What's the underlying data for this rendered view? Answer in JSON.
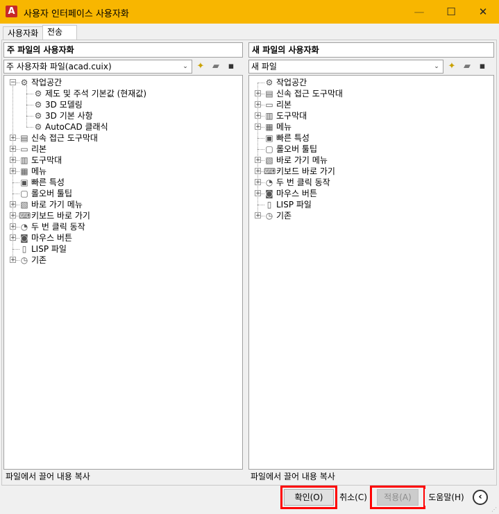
{
  "window": {
    "title": "사용자 인터페이스 사용자화",
    "app_icon_letter": "A",
    "minimize_glyph": "—",
    "maximize_glyph": "☐",
    "close_glyph": "✕"
  },
  "tabs": [
    {
      "label": "사용자화",
      "active": false
    },
    {
      "label": "전송",
      "active": true
    }
  ],
  "left_pane": {
    "header": "주 파일의 사용자화",
    "file_combo_value": "주 사용자화 파일(acad.cuix)",
    "status": "파일에서 끌어 내용 복사",
    "tree": [
      {
        "label": "작업공간",
        "level": 0,
        "icon": "workspace-gear-icon",
        "glyph": "⚙",
        "expander": "−"
      },
      {
        "label": "제도 및 주석 기본값 (현재값)",
        "level": 1,
        "icon": "gear-icon",
        "glyph": "⚙",
        "expander": ""
      },
      {
        "label": "3D 모델링",
        "level": 1,
        "icon": "gear-icon",
        "glyph": "⚙",
        "expander": ""
      },
      {
        "label": "3D 기본 사항",
        "level": 1,
        "icon": "gear-icon",
        "glyph": "⚙",
        "expander": ""
      },
      {
        "label": "AutoCAD 클래식",
        "level": 1,
        "icon": "gear-icon",
        "glyph": "⚙",
        "expander": ""
      },
      {
        "label": "신속 접근 도구막대",
        "level": 0,
        "icon": "quick-access-toolbar-icon",
        "glyph": "▤",
        "expander": "+"
      },
      {
        "label": "리본",
        "level": 0,
        "icon": "ribbon-folder-icon",
        "glyph": "▭",
        "expander": "+"
      },
      {
        "label": "도구막대",
        "level": 0,
        "icon": "toolbar-icon",
        "glyph": "▥",
        "expander": "+"
      },
      {
        "label": "메뉴",
        "level": 0,
        "icon": "menu-icon",
        "glyph": "▦",
        "expander": "+"
      },
      {
        "label": "빠른 특성",
        "level": 0,
        "icon": "quick-properties-icon",
        "glyph": "▣",
        "expander": ""
      },
      {
        "label": "롤오버 툴팁",
        "level": 0,
        "icon": "rollover-tooltip-icon",
        "glyph": "▢",
        "expander": ""
      },
      {
        "label": "바로 가기 메뉴",
        "level": 0,
        "icon": "shortcut-menu-icon",
        "glyph": "▧",
        "expander": "+"
      },
      {
        "label": "키보드 바로 가기",
        "level": 0,
        "icon": "keyboard-shortcut-icon",
        "glyph": "⌨",
        "expander": "+"
      },
      {
        "label": "두 번 클릭 동작",
        "level": 0,
        "icon": "double-click-icon",
        "glyph": "◔",
        "expander": "+"
      },
      {
        "label": "마우스 버튼",
        "level": 0,
        "icon": "mouse-button-icon",
        "glyph": "◙",
        "expander": "+"
      },
      {
        "label": "LISP 파일",
        "level": 0,
        "icon": "lisp-file-icon",
        "glyph": "▯",
        "expander": ""
      },
      {
        "label": "기존",
        "level": 0,
        "icon": "legacy-clock-icon",
        "glyph": "◷",
        "expander": "+"
      }
    ]
  },
  "right_pane": {
    "header": "새 파일의 사용자화",
    "file_combo_value": "새 파일",
    "status": "파일에서 끌어 내용 복사",
    "tree": [
      {
        "label": "작업공간",
        "level": 0,
        "icon": "workspace-gear-icon",
        "glyph": "⚙",
        "expander": ""
      },
      {
        "label": "신속 접근 도구막대",
        "level": 0,
        "icon": "quick-access-toolbar-icon",
        "glyph": "▤",
        "expander": "+"
      },
      {
        "label": "리본",
        "level": 0,
        "icon": "ribbon-folder-icon",
        "glyph": "▭",
        "expander": "+"
      },
      {
        "label": "도구막대",
        "level": 0,
        "icon": "toolbar-icon",
        "glyph": "▥",
        "expander": "+"
      },
      {
        "label": "메뉴",
        "level": 0,
        "icon": "menu-icon",
        "glyph": "▦",
        "expander": "+"
      },
      {
        "label": "빠른 특성",
        "level": 0,
        "icon": "quick-properties-icon",
        "glyph": "▣",
        "expander": ""
      },
      {
        "label": "롤오버 툴팁",
        "level": 0,
        "icon": "rollover-tooltip-icon",
        "glyph": "▢",
        "expander": ""
      },
      {
        "label": "바로 가기 메뉴",
        "level": 0,
        "icon": "shortcut-menu-icon",
        "glyph": "▧",
        "expander": "+"
      },
      {
        "label": "키보드 바로 가기",
        "level": 0,
        "icon": "keyboard-shortcut-icon",
        "glyph": "⌨",
        "expander": "+"
      },
      {
        "label": "두 번 클릭 동작",
        "level": 0,
        "icon": "double-click-icon",
        "glyph": "◔",
        "expander": "+"
      },
      {
        "label": "마우스 버튼",
        "level": 0,
        "icon": "mouse-button-icon",
        "glyph": "◙",
        "expander": "+"
      },
      {
        "label": "LISP 파일",
        "level": 0,
        "icon": "lisp-file-icon",
        "glyph": "▯",
        "expander": ""
      },
      {
        "label": "기존",
        "level": 0,
        "icon": "legacy-clock-icon",
        "glyph": "◷",
        "expander": "+"
      }
    ]
  },
  "toolbar_icons": {
    "new": "✦",
    "open": "▰",
    "save": "▪",
    "dropdown": "⌄"
  },
  "buttons": {
    "ok": "확인(O)",
    "cancel": "취소(C)",
    "apply": "적용(A)",
    "help": "도움말(H)",
    "collapse": "‹"
  },
  "colors": {
    "titlebar": "#f8b600",
    "highlight_box": "#ff0000"
  }
}
